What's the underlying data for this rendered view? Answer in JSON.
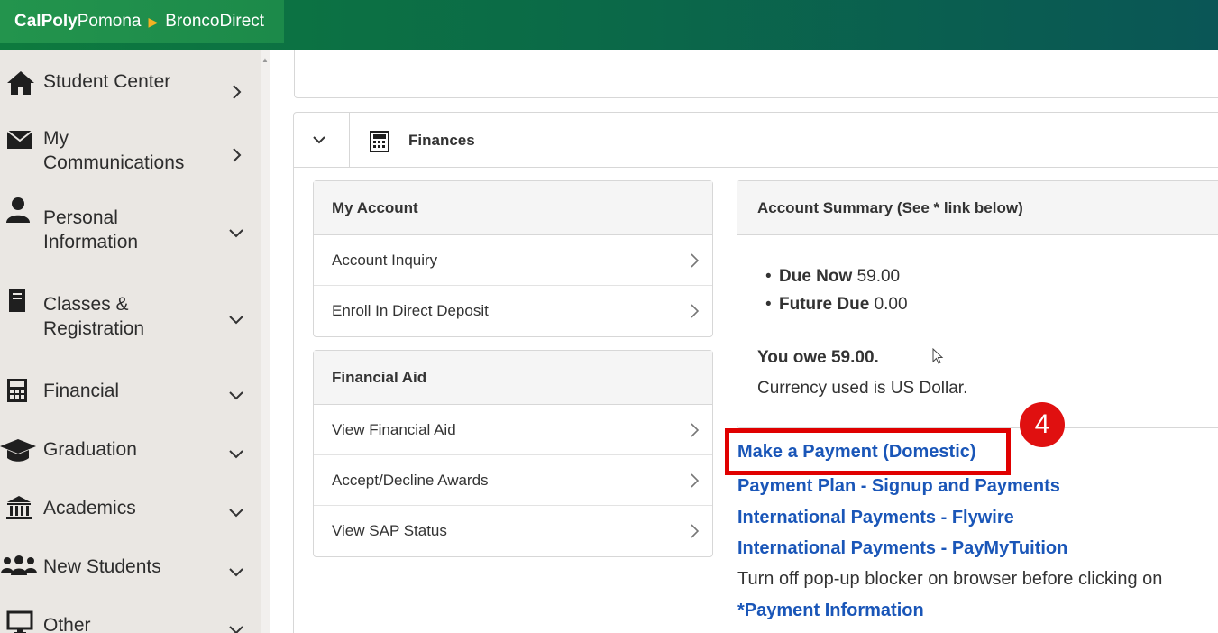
{
  "header": {
    "brand_bold": "CalPoly",
    "brand_light": "Pomona",
    "app_name": "BroncoDirect"
  },
  "sidebar": {
    "items": [
      {
        "label": "Student Center",
        "icon": "home-icon",
        "chevron": "right"
      },
      {
        "label": "My Communications",
        "icon": "envelope-icon",
        "chevron": "right"
      },
      {
        "label": "Personal Information",
        "icon": "user-icon",
        "chevron": "down"
      },
      {
        "label": "Classes & Registration",
        "icon": "book-icon",
        "chevron": "down"
      },
      {
        "label": "Financial",
        "icon": "calculator-icon",
        "chevron": "down"
      },
      {
        "label": "Graduation",
        "icon": "graduation-cap-icon",
        "chevron": "down"
      },
      {
        "label": "Academics",
        "icon": "university-icon",
        "chevron": "down"
      },
      {
        "label": "New Students",
        "icon": "users-icon",
        "chevron": "down"
      },
      {
        "label": "Other",
        "icon": "monitor-icon",
        "chevron": "down"
      }
    ]
  },
  "finances": {
    "title": "Finances",
    "my_account": {
      "title": "My Account",
      "items": [
        "Account Inquiry",
        "Enroll In Direct Deposit"
      ]
    },
    "financial_aid": {
      "title": "Financial Aid",
      "items": [
        "View Financial Aid",
        "Accept/Decline Awards",
        "View SAP Status"
      ]
    },
    "account_summary": {
      "title": "Account Summary (See * link below)",
      "due_now_label": "Due Now",
      "due_now_value": "59.00",
      "future_due_label": "Future Due",
      "future_due_value": "0.00",
      "owe_text": "You owe 59.00.",
      "currency_text": "Currency used is US Dollar."
    },
    "links": {
      "make_payment": "Make a Payment (Domestic)",
      "payment_plan": "Payment Plan - Signup and Payments",
      "intl_flywire": "International Payments - Flywire",
      "intl_paymytuition": "International Payments - PayMyTuition",
      "popup_note": "Turn off pop-up blocker on browser before clicking on",
      "payment_info": "*Payment Information"
    }
  },
  "annotation": {
    "step_number": "4",
    "color": "#e00000"
  },
  "colors": {
    "brand_green": "#1c8a4a",
    "link_blue": "#1a56b8",
    "sidebar_bg": "#eae7e3"
  }
}
